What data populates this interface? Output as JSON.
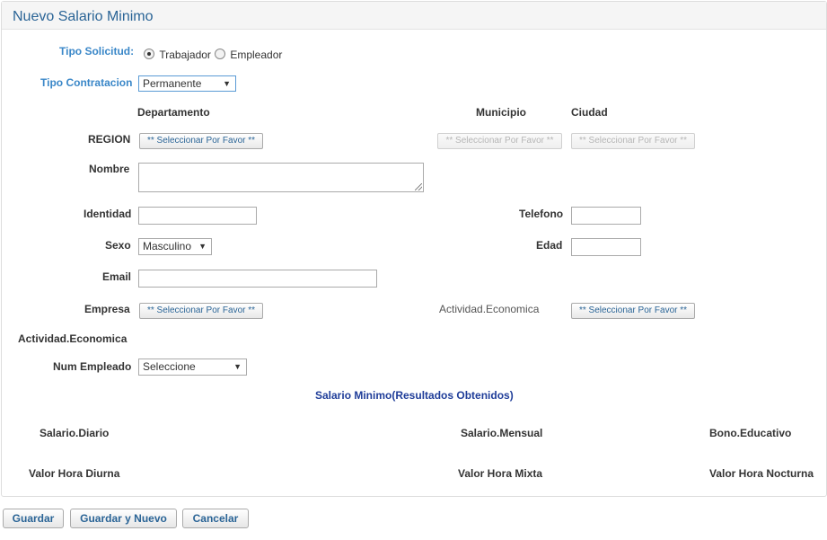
{
  "panel": {
    "title": "Nuevo Salario Minimo"
  },
  "form": {
    "tipo_solicitud": {
      "label": "Tipo Solicitud:",
      "options": [
        "Trabajador",
        "Empleador"
      ],
      "selected": "Trabajador"
    },
    "tipo_contratacion": {
      "label": "Tipo Contratacion",
      "value": "Permanente"
    },
    "col_headers": {
      "departamento": "Departamento",
      "municipio": "Municipio",
      "ciudad": "Ciudad"
    },
    "region": {
      "label": "REGION",
      "departamento_btn": "** Seleccionar Por Favor **",
      "municipio_btn": "** Seleccionar Por Favor **",
      "ciudad_btn": "** Seleccionar Por Favor **"
    },
    "nombre": {
      "label": "Nombre",
      "value": ""
    },
    "identidad": {
      "label": "Identidad",
      "value": ""
    },
    "telefono": {
      "label": "Telefono",
      "value": ""
    },
    "sexo": {
      "label": "Sexo",
      "value": "Masculino"
    },
    "edad": {
      "label": "Edad",
      "value": ""
    },
    "email": {
      "label": "Email",
      "value": ""
    },
    "empresa": {
      "label": "Empresa",
      "btn": "** Seleccionar Por Favor **"
    },
    "actividad_economica_inline": {
      "label": "Actividad.Economica",
      "btn": "** Seleccionar Por Favor **"
    },
    "actividad_economica_row": {
      "label": "Actividad.Economica"
    },
    "num_empleado": {
      "label": "Num Empleado",
      "value": "Seleccione"
    }
  },
  "results": {
    "title": "Salario Minimo(Resultados Obtenidos)",
    "salario_diario": "Salario.Diario",
    "salario_mensual": "Salario.Mensual",
    "bono_educativo": "Bono.Educativo",
    "valor_hora_diurna": "Valor Hora Diurna",
    "valor_hora_mixta": "Valor Hora Mixta",
    "valor_hora_nocturna": "Valor Hora Nocturna"
  },
  "actions": {
    "guardar": "Guardar",
    "guardar_nuevo": "Guardar y Nuevo",
    "cancelar": "Cancelar"
  },
  "icons": {
    "dropdown": "▼"
  },
  "colors": {
    "title": "#2a6496",
    "label_blue": "#3a87c8",
    "section_title": "#1f3d99"
  }
}
